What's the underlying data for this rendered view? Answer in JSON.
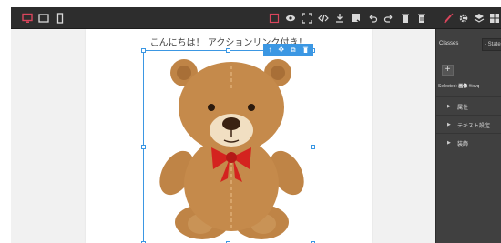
{
  "toolbar": {
    "devices": [
      "desktop-icon",
      "tablet-icon",
      "mobile-icon"
    ],
    "options": [
      "sw-visibility-icon",
      "preview-icon",
      "fullscreen-icon",
      "code-icon",
      "import-icon",
      "export-icon",
      "undo-icon",
      "redo-icon",
      "delete-icon",
      "clear-canvas-icon"
    ],
    "panels": [
      "style-manager-icon",
      "settings-icon",
      "layer-manager-icon",
      "blocks-icon"
    ],
    "accent": "#d9455c",
    "active": "#3b97e3"
  },
  "canvas": {
    "headline": "こんにちは！ アクションリンク付き！"
  },
  "selection": {
    "tools": [
      "↑",
      "✥",
      "⧉",
      "🗑"
    ]
  },
  "panel": {
    "classes_label": "Classes",
    "state_label": "- State -",
    "add_label": "+",
    "selected_prefix": "Selected:",
    "selected_name": "画像",
    "selected_id": "#ixvq",
    "sectors": [
      "属性",
      "テキスト設定",
      "装飾"
    ]
  }
}
